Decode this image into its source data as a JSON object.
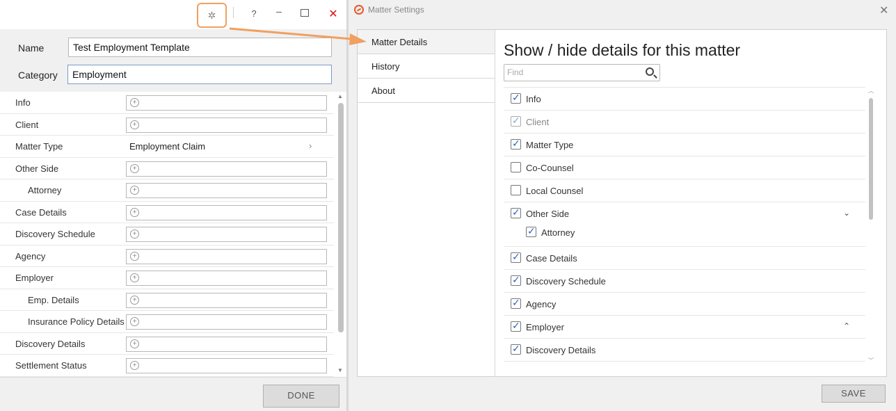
{
  "left_window": {
    "titlebar": {
      "help": "?",
      "minimize": "–",
      "close": "✕"
    },
    "name_label": "Name",
    "name_value": "Test Employment Template",
    "category_label": "Category",
    "category_value": "Employment",
    "rows": [
      {
        "label": "Info"
      },
      {
        "label": "Client"
      },
      {
        "label": "Matter Type",
        "value": "Employment Claim"
      },
      {
        "label": "Other Side"
      },
      {
        "label": "Attorney"
      },
      {
        "label": "Case Details"
      },
      {
        "label": "Discovery Schedule"
      },
      {
        "label": "Agency"
      },
      {
        "label": "Employer"
      },
      {
        "label": "Emp. Details"
      },
      {
        "label": "Insurance Policy Details"
      },
      {
        "label": "Discovery Details"
      },
      {
        "label": "Settlement Status"
      }
    ],
    "done_label": "DONE"
  },
  "right_window": {
    "title": "Matter Settings",
    "nav": [
      {
        "label": "Matter Details"
      },
      {
        "label": "History"
      },
      {
        "label": "About"
      }
    ],
    "heading": "Show / hide details for this matter",
    "find_placeholder": "Find",
    "items": [
      {
        "label": "Info",
        "checked": true
      },
      {
        "label": "Client",
        "checked": true,
        "disabled": true
      },
      {
        "label": "Matter Type",
        "checked": true
      },
      {
        "label": "Co-Counsel",
        "checked": false
      },
      {
        "label": "Local Counsel",
        "checked": false
      },
      {
        "label": "Other Side",
        "checked": true,
        "expanded": true
      },
      {
        "label": "Attorney",
        "checked": true
      },
      {
        "label": "Case Details",
        "checked": true
      },
      {
        "label": "Discovery Schedule",
        "checked": true
      },
      {
        "label": "Agency",
        "checked": true
      },
      {
        "label": "Employer",
        "checked": true,
        "collapsed": true
      },
      {
        "label": "Discovery Details",
        "checked": true
      }
    ],
    "save_label": "SAVE"
  },
  "colors": {
    "accent_orange": "#f0a060",
    "logo": "#e25a2c",
    "check": "#2b62c4",
    "close_red": "#dd1111"
  }
}
